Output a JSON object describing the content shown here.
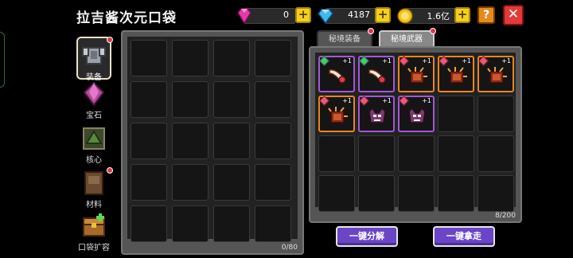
{
  "header": {
    "title": "拉吉酱次元口袋"
  },
  "currencies": {
    "pink_gem": {
      "value": "0",
      "icon": "pink-gem-icon",
      "color": "#e43aa8"
    },
    "blue_gem": {
      "value": "4187",
      "icon": "blue-diamond-icon",
      "color": "#3fb8ee"
    },
    "gold_coin": {
      "value": "1.6亿",
      "icon": "gold-coin-icon",
      "color": "#f2c21a"
    }
  },
  "buttons": {
    "help": "?",
    "close": "✕",
    "plus": "+",
    "decompose_all": "一键分解",
    "take_all": "一键拿走"
  },
  "sidebar": {
    "items": [
      {
        "label": "装备",
        "icon": "equipment-armor-icon",
        "active": true,
        "notify": true
      },
      {
        "label": "宝石",
        "icon": "gem-crystal-icon",
        "active": false,
        "notify": false
      },
      {
        "label": "核心",
        "icon": "core-emblem-icon",
        "active": false,
        "notify": false
      },
      {
        "label": "材料",
        "icon": "material-book-icon",
        "active": false,
        "notify": true
      },
      {
        "label": "口袋扩容",
        "icon": "chest-expand-icon",
        "active": false,
        "notify": false
      }
    ]
  },
  "left_panel": {
    "capacity": "0/80"
  },
  "right_panel": {
    "tabs": [
      {
        "label": "秘境装备",
        "active": false,
        "notify": true
      },
      {
        "label": "秘境武器",
        "active": true,
        "notify": true
      }
    ],
    "capacity": "8/200",
    "items": [
      {
        "name": "horn-weapon",
        "icon": "horn-icon",
        "quality": "purple",
        "badge": "green",
        "level": "+1"
      },
      {
        "name": "horn-weapon",
        "icon": "horn-icon",
        "quality": "purple",
        "badge": "green",
        "level": "+1"
      },
      {
        "name": "spiked-gauntlet",
        "icon": "spiked-gauntlet-icon",
        "quality": "orange",
        "badge": "red",
        "level": "+1"
      },
      {
        "name": "spiked-gauntlet",
        "icon": "spiked-gauntlet-icon",
        "quality": "orange",
        "badge": "red",
        "level": "+1"
      },
      {
        "name": "spiked-gauntlet",
        "icon": "spiked-gauntlet-icon",
        "quality": "orange",
        "badge": "red",
        "level": "+1"
      },
      {
        "name": "spiked-gauntlet",
        "icon": "spiked-gauntlet-icon",
        "quality": "orange",
        "badge": "red",
        "level": "+1"
      },
      {
        "name": "demon-mask",
        "icon": "demon-mask-icon",
        "quality": "purple",
        "badge": "red",
        "level": "+1"
      },
      {
        "name": "demon-mask",
        "icon": "demon-mask-icon",
        "quality": "purple",
        "badge": "red",
        "level": "+1"
      }
    ]
  }
}
